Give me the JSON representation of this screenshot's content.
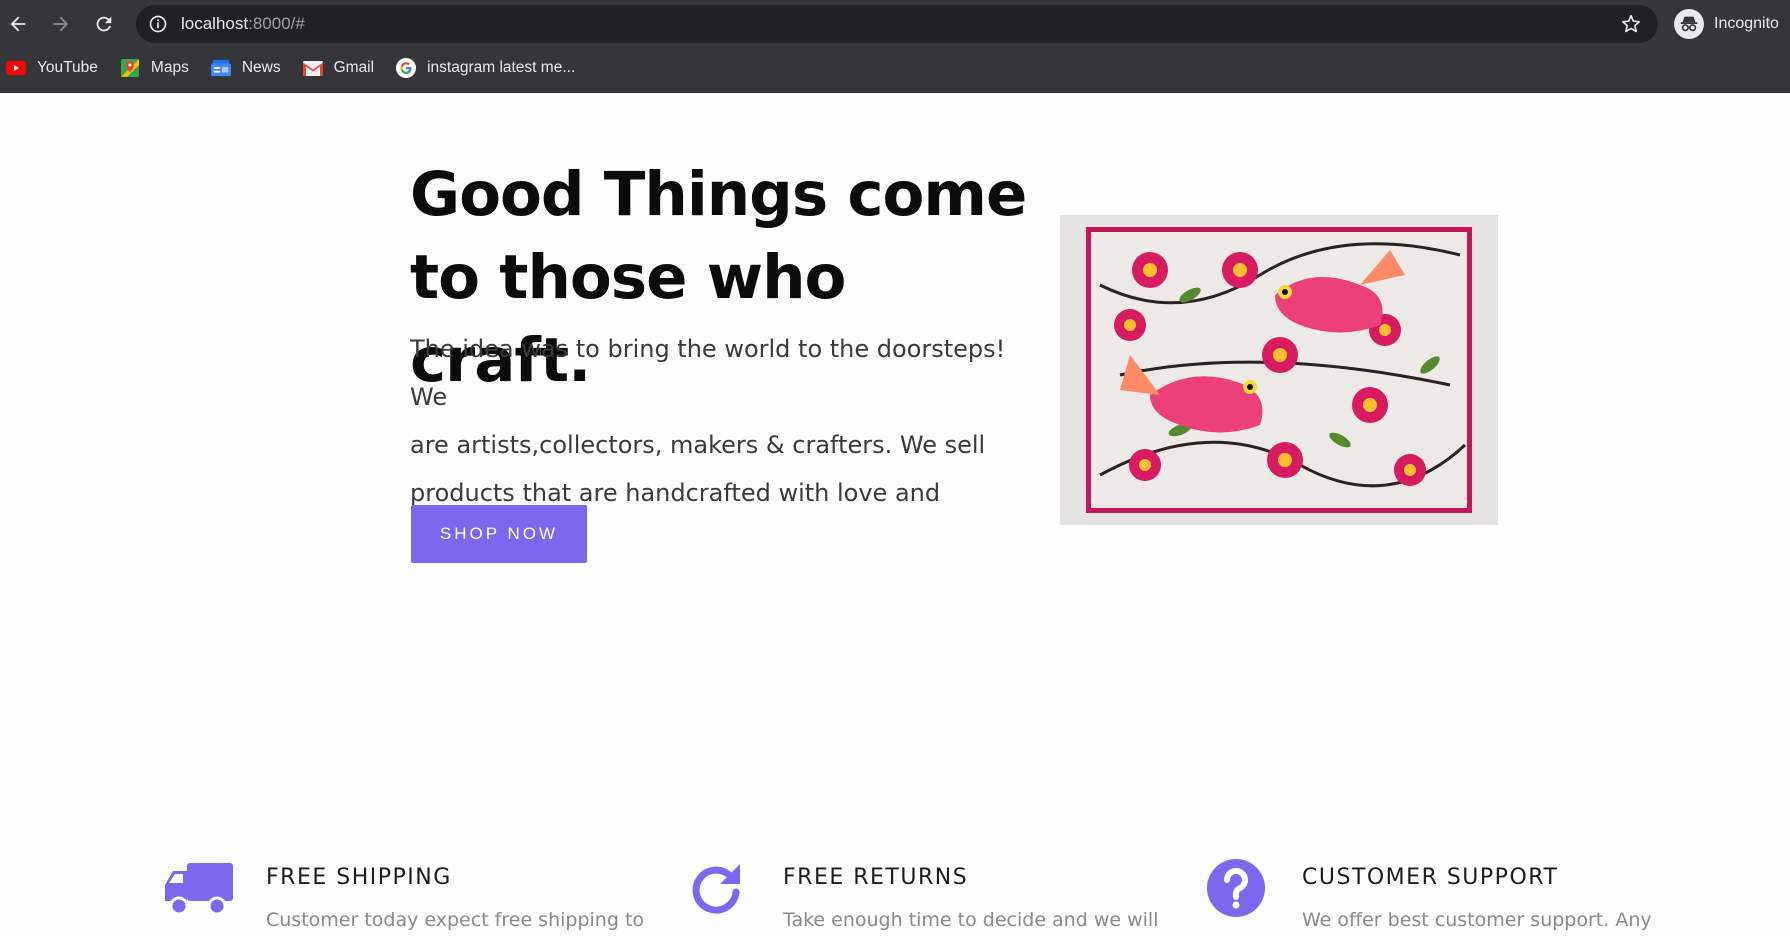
{
  "browser": {
    "url_host": "localhost",
    "url_path": ":8000/#",
    "profile_label": "Incognito",
    "bookmarks": [
      {
        "label": "YouTube",
        "icon": "youtube-icon"
      },
      {
        "label": "Maps",
        "icon": "maps-icon"
      },
      {
        "label": "News",
        "icon": "news-icon"
      },
      {
        "label": "Gmail",
        "icon": "gmail-icon"
      },
      {
        "label": "instagram latest me...",
        "icon": "google-icon"
      }
    ]
  },
  "hero": {
    "title_line1": "Good Things come",
    "title_line2": "to those who craft.",
    "text_line1": "The idea was to bring the world to the doorsteps! We",
    "text_line2": "are artists,collectors, makers & crafters. We sell",
    "text_line3": "products that are handcrafted with love and efforts.",
    "button_label": "SHOP NOW",
    "image_icon": "madhubani-painting-image"
  },
  "features": [
    {
      "title": "FREE SHIPPING",
      "text": "Customer today expect free shipping to",
      "icon": "truck-icon"
    },
    {
      "title": "FREE RETURNS",
      "text": "Take enough time to decide and we will",
      "icon": "refresh-icon"
    },
    {
      "title": "CUSTOMER SUPPORT",
      "text": "We offer best customer support. Any",
      "icon": "question-icon"
    }
  ],
  "colors": {
    "accent": "#7b68ee",
    "chrome_bg": "#35363a",
    "omnibox_bg": "#202124"
  }
}
